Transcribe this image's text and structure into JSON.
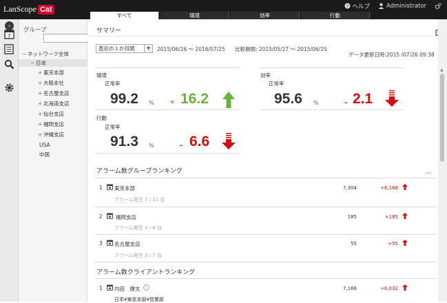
{
  "app": {
    "logo_text": "LanScope",
    "logo_badge": "Cat",
    "help": "ヘルプ",
    "user": "Administrator"
  },
  "tabs": [
    "すべて",
    "環境",
    "効率",
    "行動"
  ],
  "sidebar": {
    "title": "グループ",
    "search_placeholder": "",
    "tree": [
      {
        "label": "ネットワーク全体",
        "toggle": "−"
      },
      {
        "label": "日本",
        "toggle": "−"
      },
      {
        "label": "東京本部",
        "toggle": "+"
      },
      {
        "label": "大阪本社",
        "toggle": "+"
      },
      {
        "label": "名古屋支店",
        "toggle": "+"
      },
      {
        "label": "北海道支店",
        "toggle": "+"
      },
      {
        "label": "仙台支店",
        "toggle": "+"
      },
      {
        "label": "福岡支店",
        "toggle": "+"
      },
      {
        "label": "沖縄支店",
        "toggle": "+"
      },
      {
        "label": "USA",
        "toggle": ""
      },
      {
        "label": "中国",
        "toggle": ""
      }
    ]
  },
  "summary": {
    "title": "サマリー",
    "range_select": "直近の１か月間",
    "period": "2015/06/26 ～ 2016/07/25",
    "compare_period": "比較期間: 2015/05/27 ～ 2015/06/25",
    "updated": "データ更新日時:2015 /07/26 09:38"
  },
  "metrics": {
    "env": {
      "head": "環境",
      "sub": "正常率",
      "value": "99.2",
      "pct": "%",
      "sign": "+",
      "diff": "16.2"
    },
    "eff": {
      "head": "効率",
      "sub": "正常率",
      "value": "95.6",
      "pct": "%",
      "sign": "-",
      "diff": "2.1"
    },
    "act": {
      "head": "行動",
      "sub": "正常率",
      "value": "91.3",
      "pct": "%",
      "sign": "-",
      "diff": "6.6"
    }
  },
  "group_ranking": {
    "title": "アラーム数グループランキング",
    "rows": [
      {
        "rank": "1",
        "name": "東京本部",
        "sub": "アラーム発生 7 / 11 台",
        "count": "7,304",
        "diff": "+6,168"
      },
      {
        "rank": "2",
        "name": "福岡支店",
        "sub": "アラーム発生 4 / 8 台",
        "count": "185",
        "diff": "+185"
      },
      {
        "rank": "3",
        "name": "名古屋支店",
        "sub": "アラーム発生 3 / 7 台",
        "count": "55",
        "diff": "+55"
      }
    ]
  },
  "client_ranking": {
    "title": "アラーム数クライアントランキング",
    "rows": [
      {
        "rank": "1",
        "name": "内田　健太",
        "sub": "日本¥東京本部¥営業部",
        "count": "7,168",
        "diff": "+6,032"
      }
    ]
  },
  "colors": {
    "green": "#6ab23c",
    "red": "#d10f0f",
    "topbar": "#1b1b1b",
    "brand": "#d6002a"
  }
}
